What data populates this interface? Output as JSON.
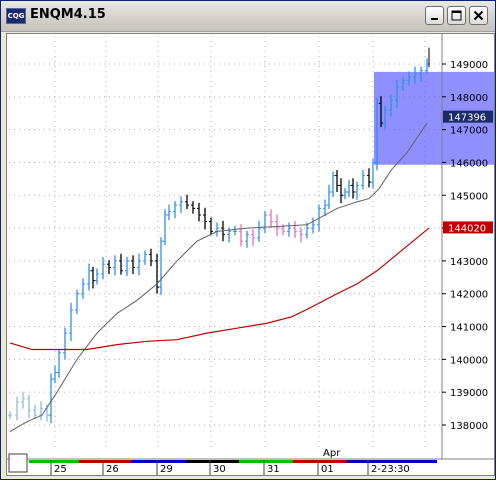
{
  "window": {
    "title": "ENQM4.15",
    "app_icon_label": "CQG",
    "controls": [
      "minimize",
      "maximize",
      "close"
    ]
  },
  "chart_data": {
    "type": "candlestick",
    "symbol": "ENQM4.15",
    "y_axis": {
      "ticks": [
        "138000",
        "139000",
        "140000",
        "141000",
        "142000",
        "143000",
        "144000",
        "145000",
        "146000",
        "147000",
        "148000",
        "149000"
      ],
      "range": [
        13760,
        14960
      ],
      "tick_values": [
        13800,
        13900,
        14000,
        14100,
        14200,
        14300,
        14400,
        14500,
        14600,
        14700,
        14800,
        14900
      ],
      "last_price_label": "147396",
      "last_price_value": 14739.6,
      "ma_value_label": "144020",
      "ma_value": 14402.0
    },
    "x_axis": {
      "session_labels": [
        "25",
        "26",
        "29",
        "30",
        "31",
        "01",
        "2-23:30"
      ],
      "month_label": "Apr",
      "session_colors": [
        "#00c000",
        "#c00000",
        "#0000c0",
        "#000000",
        "#00c000",
        "#c00000",
        "#0000c0"
      ]
    },
    "highlight_box": {
      "y_range": [
        14593,
        14876
      ]
    },
    "colors": {
      "up_bar": "#2f8ff0",
      "down_bar": "#000000",
      "pink_bar": "#e070c0",
      "light_bar": "#90b8e8",
      "fast_ma": "#606060",
      "slow_ma": "#c00000",
      "highlight": "#6060ff",
      "last_price_box": "#1a2b6c",
      "ma_box": "#c00000"
    }
  }
}
